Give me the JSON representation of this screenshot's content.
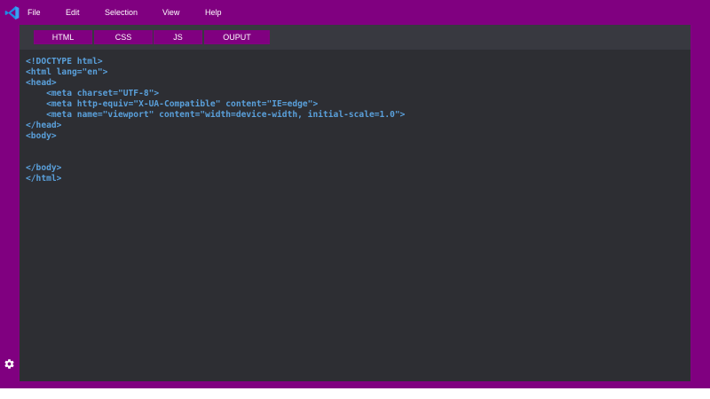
{
  "menubar": {
    "items": [
      {
        "label": "File"
      },
      {
        "label": "Edit"
      },
      {
        "label": "Selection"
      },
      {
        "label": "View"
      },
      {
        "label": "Help"
      }
    ]
  },
  "tabs": [
    {
      "label": "HTML"
    },
    {
      "label": "CSS"
    },
    {
      "label": "JS"
    },
    {
      "label": "OUPUT"
    }
  ],
  "code": {
    "lines": [
      "<!DOCTYPE html>",
      "<html lang=\"en\">",
      "<head>",
      "    <meta charset=\"UTF-8\">",
      "    <meta http-equiv=\"X-UA-Compatible\" content=\"IE=edge\">",
      "    <meta name=\"viewport\" content=\"width=device-width, initial-scale=1.0\">",
      "</head>",
      "<body>",
      "",
      "",
      "</body>",
      "</html>"
    ]
  },
  "icons": {
    "logo": "vscode-logo-icon",
    "settings": "gear-icon"
  },
  "colors": {
    "frame": "#800080",
    "editor_bg": "#2d2e33",
    "tabbar_bg": "#383940",
    "code_text": "#5aa0db",
    "logo_blue": "#1e8ce6"
  }
}
